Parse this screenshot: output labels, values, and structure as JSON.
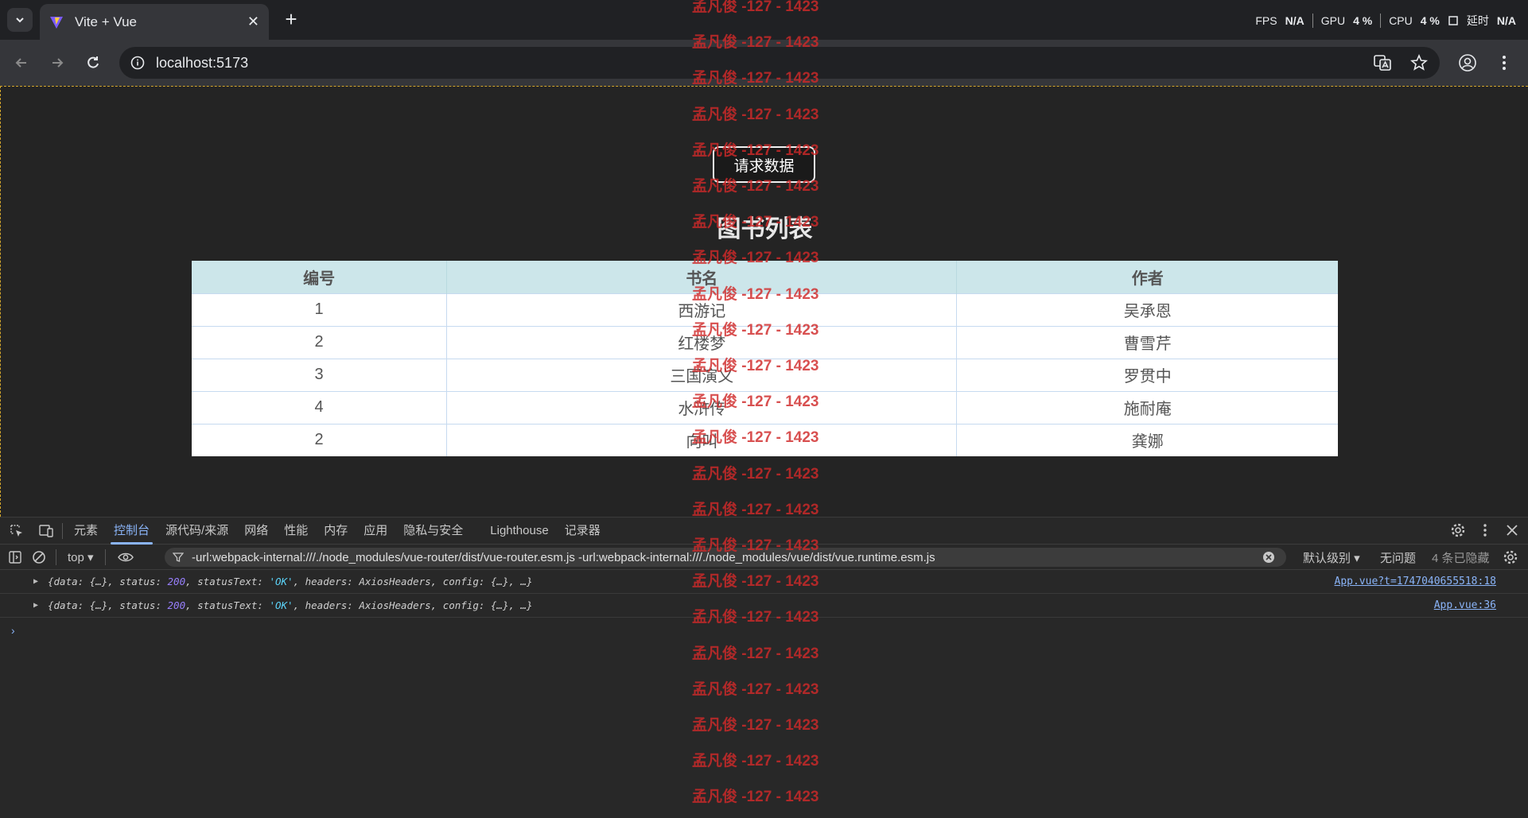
{
  "browser": {
    "tab_title": "Vite + Vue",
    "tab_close": "✕",
    "new_tab": "+",
    "url": "localhost:5173",
    "perf": {
      "fps_label": "FPS",
      "fps_value": "N/A",
      "gpu_label": "GPU",
      "gpu_value": "4 %",
      "cpu_label": "CPU",
      "cpu_value": "4 %",
      "latency_label": "延时",
      "latency_value": "N/A"
    }
  },
  "page": {
    "request_button": "请求数据",
    "table_title": "图书列表",
    "columns": [
      "编号",
      "书名",
      "作者"
    ],
    "rows": [
      [
        "1",
        "西游记",
        "吴承恩"
      ],
      [
        "2",
        "红楼梦",
        "曹雪芹"
      ],
      [
        "3",
        "三国演义",
        "罗贯中"
      ],
      [
        "4",
        "水浒传",
        "施耐庵"
      ],
      [
        "2",
        "向叫",
        "龚娜"
      ]
    ]
  },
  "devtools": {
    "tabs": [
      "元素",
      "控制台",
      "源代码/来源",
      "网络",
      "性能",
      "内存",
      "应用",
      "隐私与安全",
      "Lighthouse",
      "记录器"
    ],
    "active_tab": "控制台",
    "context": "top ▾",
    "filter": "-url:webpack-internal:///./node_modules/vue-router/dist/vue-router.esm.js -url:webpack-internal:///./node_modules/vue/dist/vue.runtime.esm.js",
    "level": "默认级别 ▾",
    "issues": "无问题",
    "hidden": "4 条已隐藏",
    "logs": [
      {
        "p1": "{data: {…}, status: ",
        "status": "200",
        "p2": ", statusText: ",
        "statusText": "'OK'",
        "p3": ", headers: AxiosHeaders, config: {…}, …}",
        "source": "App.vue?t=1747040655518:18"
      },
      {
        "p1": "{data: {…}, status: ",
        "status": "200",
        "p2": ", statusText: ",
        "statusText": "'OK'",
        "p3": ", headers: AxiosHeaders, config: {…}, …}",
        "source": "App.vue:36"
      }
    ],
    "prompt": "›"
  },
  "watermark": {
    "text": "孟凡俊 -127 - 1423",
    "count": 23
  },
  "colors": {
    "accent": "#8ab4f8",
    "table_header_bg": "#cce6ea",
    "watermark": "#d02a2a"
  }
}
